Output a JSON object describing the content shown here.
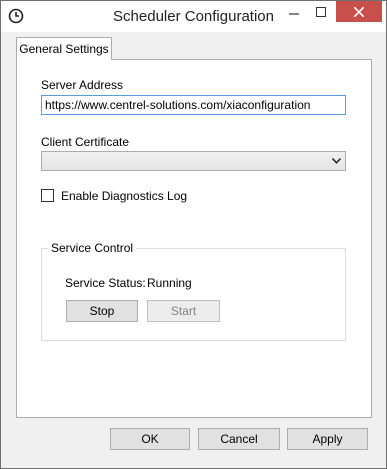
{
  "window": {
    "title": "Scheduler Configuration",
    "app_icon": "clock-icon",
    "controls": [
      "minimize-icon",
      "maximize-icon",
      "close-icon"
    ],
    "close_color": "#c7504b"
  },
  "tabs": [
    {
      "label": "General Settings",
      "selected": true
    }
  ],
  "general": {
    "server_address_label": "Server Address",
    "server_address_value": "https://www.centrel-solutions.com/xiaconfiguration",
    "client_certificate_label": "Client Certificate",
    "client_certificate_value": "",
    "diagnostics_label": "Enable Diagnostics Log",
    "diagnostics_checked": false
  },
  "service_control": {
    "legend": "Service Control",
    "status_label": "Service Status:",
    "status_value": "Running",
    "stop_label": "Stop",
    "start_label": "Start",
    "start_enabled": false
  },
  "footer": {
    "ok_label": "OK",
    "cancel_label": "Cancel",
    "apply_label": "Apply"
  }
}
